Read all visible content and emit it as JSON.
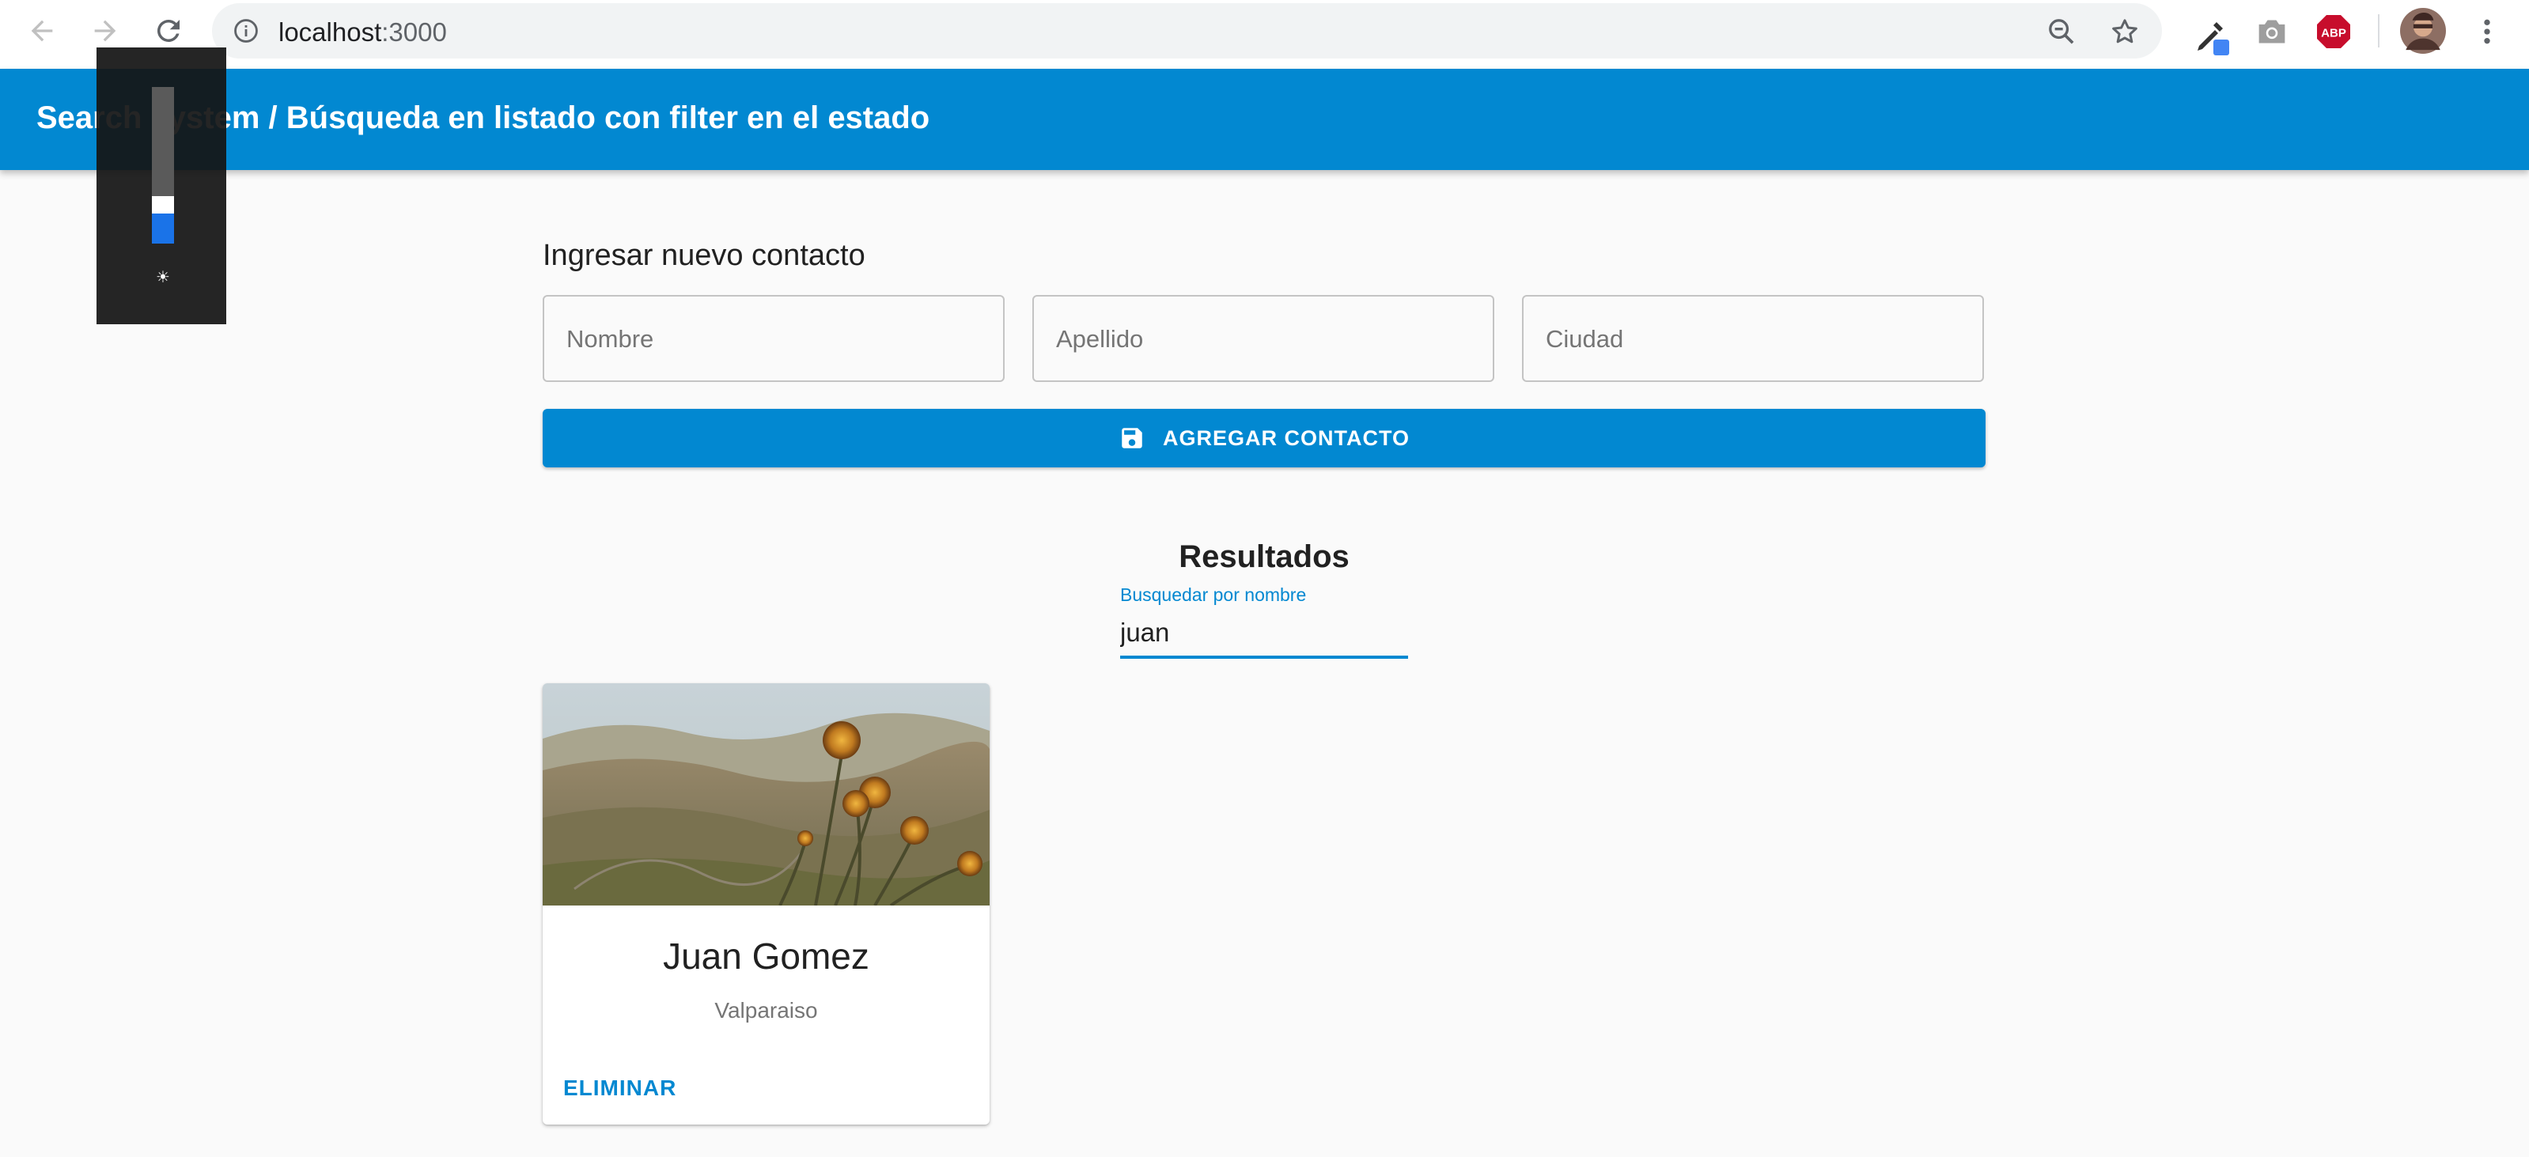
{
  "browser": {
    "url_host": "localhost",
    "url_port": ":3000",
    "icons": [
      "back-arrow-icon",
      "forward-arrow-icon",
      "reload-icon",
      "info-icon",
      "zoom-out-icon",
      "star-icon",
      "eyedropper-icon",
      "camera-icon",
      "adblock-icon",
      "profile-avatar",
      "kebab-menu-icon"
    ],
    "adblock_label": "ABP"
  },
  "appbar": {
    "title": "Search system / Búsqueda en listado con filter en el estado",
    "color": "#0288d1"
  },
  "volume_overlay": {
    "level": 0.19
  },
  "form": {
    "title": "Ingresar nuevo contacto",
    "fields": [
      {
        "placeholder": "Nombre",
        "value": ""
      },
      {
        "placeholder": "Apellido",
        "value": ""
      },
      {
        "placeholder": "Ciudad",
        "value": ""
      }
    ],
    "submit_label": "AGREGAR CONTACTO",
    "submit_icon": "save-icon"
  },
  "results": {
    "title": "Resultados",
    "search_label": "Busquedar por nombre",
    "search_value": "juan",
    "cards": [
      {
        "name": "Juan Gomez",
        "city": "Valparaiso",
        "action_label": "ELIMINAR",
        "image": "landscape-thistle-photo"
      }
    ]
  }
}
